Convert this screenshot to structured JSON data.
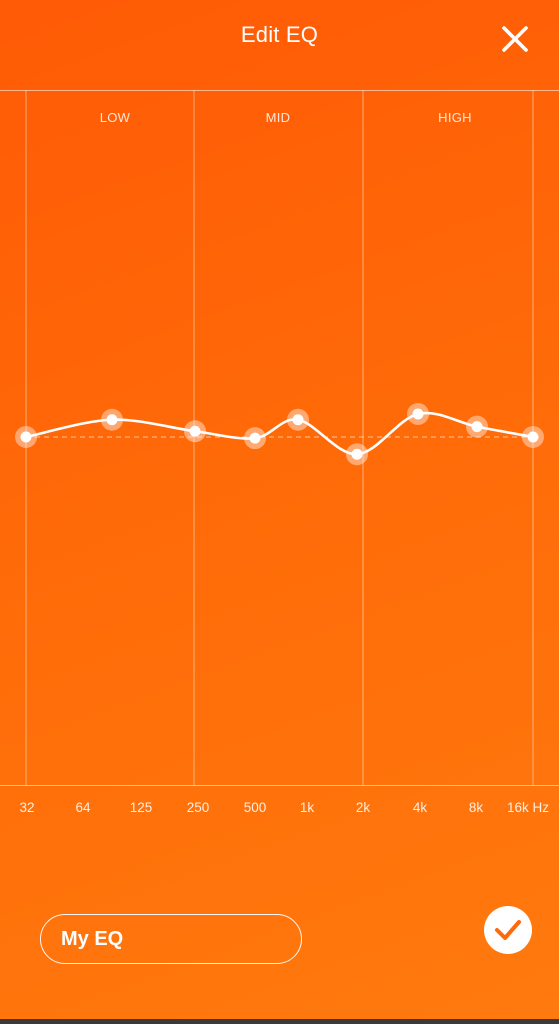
{
  "header": {
    "title": "Edit EQ",
    "close_icon": "close-icon"
  },
  "bands": [
    {
      "label": "LOW"
    },
    {
      "label": "MID"
    },
    {
      "label": "HIGH"
    }
  ],
  "frequencies": [
    "32",
    "64",
    "125",
    "250",
    "500",
    "1k",
    "2k",
    "4k",
    "8k",
    "16k Hz"
  ],
  "chart_data": {
    "type": "line",
    "x": [
      "32",
      "64",
      "125",
      "250",
      "500",
      "1k",
      "2k",
      "4k",
      "8k",
      "16k"
    ],
    "series": [
      {
        "values": [
          0,
          1.5,
          0.5,
          0,
          1.5,
          -1.5,
          2,
          1,
          0
        ]
      }
    ],
    "ylim": [
      -10,
      10
    ]
  },
  "eq_points": [
    0,
    1.5,
    0.5,
    -0.1,
    1.5,
    -1.5,
    2,
    0.9,
    0
  ],
  "preset": {
    "name": "My EQ"
  },
  "confirm_icon": "checkmark-icon",
  "colors": {
    "background_start": "#ff5a06",
    "background_end": "#ff7a0e",
    "accent": "#ffffff"
  }
}
